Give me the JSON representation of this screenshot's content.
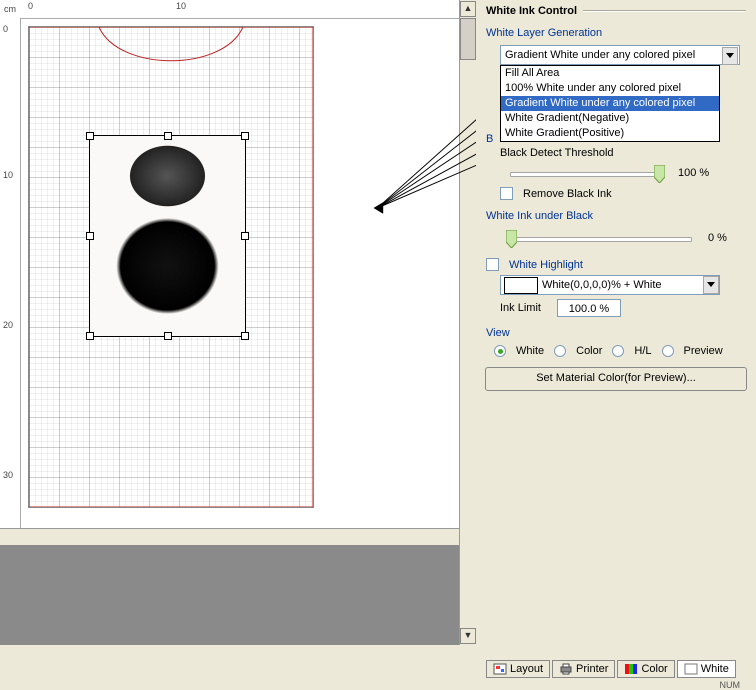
{
  "ruler": {
    "unit": "cm",
    "h0": "0",
    "h10": "10",
    "v0": "0",
    "v10": "10",
    "v20": "20",
    "v30": "30"
  },
  "panel": {
    "title": "White Ink Control",
    "white_layer_generation": {
      "title": "White Layer Generation",
      "selected": "Gradient White under any colored pixel",
      "options": [
        "Fill All Area",
        "100% White under any colored pixel",
        "Gradient White under any colored pixel",
        "White Gradient(Negative)",
        "White Gradient(Positive)"
      ]
    },
    "black_detect": {
      "prefix": "B",
      "label": "Black Detect Threshold",
      "value": "100 %",
      "remove_black_label": "Remove Black Ink",
      "remove_black_checked": false
    },
    "white_under_black": {
      "title": "White Ink under Black",
      "value": "0 %"
    },
    "white_highlight": {
      "check_label": "White Highlight",
      "checked": false,
      "hl_text": "White(0,0,0,0)% + White",
      "ink_limit_label": "Ink Limit",
      "ink_limit_value": "100.0 %"
    },
    "view": {
      "title": "View",
      "options": [
        "White",
        "Color",
        "H/L",
        "Preview"
      ],
      "selected_index": 0
    },
    "set_material_button": "Set Material Color(for Preview)..."
  },
  "tabs": {
    "layout": "Layout",
    "printer": "Printer",
    "color": "Color",
    "white": "White"
  },
  "status": {
    "right": "NUM"
  }
}
